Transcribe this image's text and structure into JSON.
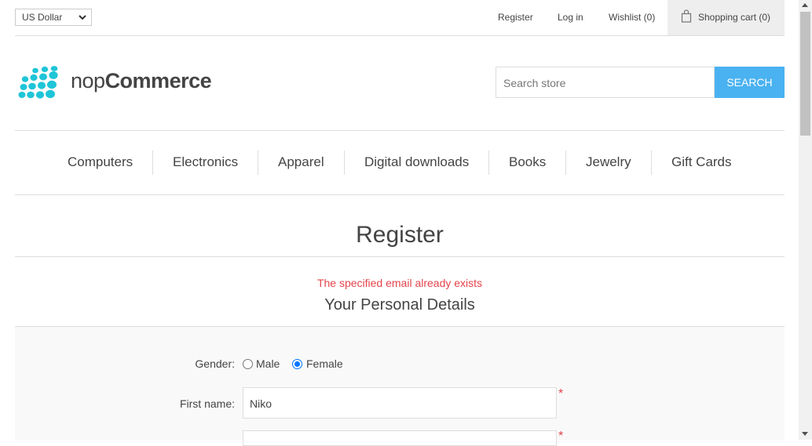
{
  "header": {
    "currency_selected": "US Dollar",
    "links": {
      "register": "Register",
      "login": "Log in",
      "wishlist": "Wishlist (0)",
      "cart": "Shopping cart (0)"
    }
  },
  "logo": {
    "text_light": "nop",
    "text_bold": "Commerce"
  },
  "search": {
    "placeholder": "Search store",
    "button": "SEARCH"
  },
  "menu": [
    "Computers",
    "Electronics",
    "Apparel",
    "Digital downloads",
    "Books",
    "Jewelry",
    "Gift Cards"
  ],
  "page": {
    "title": "Register",
    "error": "The specified email already exists",
    "section_title": "Your Personal Details"
  },
  "form": {
    "gender_label": "Gender:",
    "gender_options": [
      "Male",
      "Female"
    ],
    "gender_selected": "Female",
    "first_name_label": "First name:",
    "first_name_value": "Niko",
    "required_mark": "*"
  },
  "colors": {
    "accent": "#4ab2f1",
    "error": "#e4434b",
    "logo_dots": "#1fc5d8"
  }
}
